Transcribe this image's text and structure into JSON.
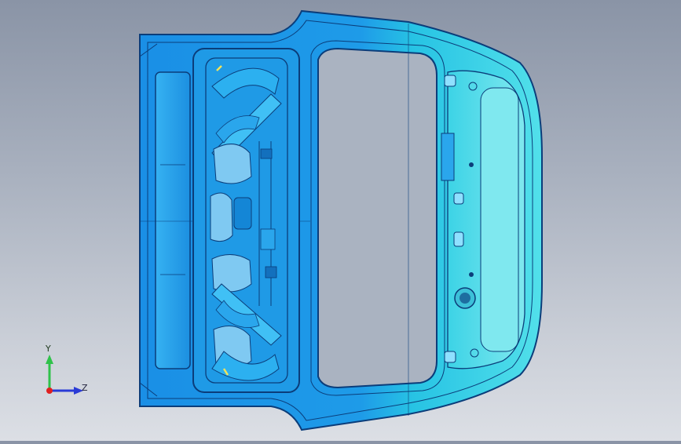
{
  "viewport": {
    "background_top": "#8a94a6",
    "background_bottom": "#dcdfe5"
  },
  "model": {
    "colors": {
      "primary": "#1e9be8",
      "secondary": "#2fd0e0",
      "edge": "#0b3d7a",
      "highlight": "#8fe0ff",
      "accent": "#f2e35a"
    }
  },
  "triad": {
    "y_label": "Y",
    "z_label": "Z",
    "y_color": "#2fc24a",
    "z_color": "#2a3bd6",
    "origin_color": "#e02020"
  }
}
